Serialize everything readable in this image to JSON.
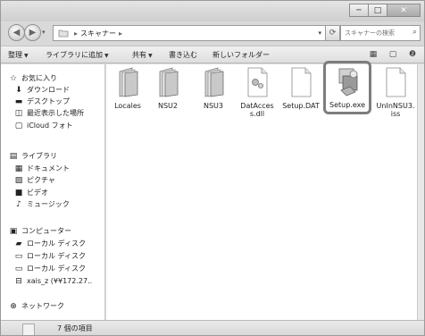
{
  "window": {
    "buttons": {
      "minimize": "─",
      "maximize": "□",
      "close": "✕"
    }
  },
  "nav": {
    "back": "◀",
    "forward": "▶",
    "history": "▾",
    "address_separator_1": "▸",
    "address_location": "スキャナー",
    "address_separator_2": "▸",
    "address_dropdown": "▾",
    "refresh": "⟳",
    "search_placeholder": "スキャナーの検索",
    "search_icon": "⌕"
  },
  "commandbar": {
    "items": [
      {
        "label": "整理",
        "dropdown": true
      },
      {
        "label": "ライブラリに追加",
        "dropdown": true
      },
      {
        "label": "共有",
        "dropdown": true
      },
      {
        "label": "書き込む",
        "dropdown": false
      },
      {
        "label": "新しいフォルダー",
        "dropdown": false
      }
    ],
    "dropdown_arrow": "▼",
    "right_icons": [
      "view-icon",
      "preview-pane-icon",
      "help-icon"
    ]
  },
  "sidebar": {
    "items": [
      {
        "label": "お気に入り",
        "icon": "star-icon",
        "glyph": "☆"
      },
      {
        "label": "ダウンロード",
        "icon": "download-icon",
        "glyph": "⬇"
      },
      {
        "label": "デスクトップ",
        "icon": "desktop-icon",
        "glyph": "▬"
      },
      {
        "label": "最近表示した場所",
        "icon": "recent-places-icon",
        "glyph": "◫"
      },
      {
        "label": "iCloud フォト",
        "icon": "icloud-icon",
        "glyph": "▢"
      },
      {
        "label": "ライブラリ",
        "icon": "library-icon",
        "glyph": "▤"
      },
      {
        "label": "ドキュメント",
        "icon": "document-icon",
        "glyph": "▦"
      },
      {
        "label": "ピクチャ",
        "icon": "picture-icon",
        "glyph": "▨"
      },
      {
        "label": "ビデオ",
        "icon": "video-icon",
        "glyph": "■"
      },
      {
        "label": "ミュージック",
        "icon": "music-icon",
        "glyph": "♪"
      },
      {
        "label": "コンピューター",
        "icon": "computer-icon",
        "glyph": "▣"
      },
      {
        "label": "ローカル ディスク",
        "icon": "local-disk-icon",
        "glyph": "▰"
      },
      {
        "label": "ローカル ディスク",
        "icon": "local-disk-icon",
        "glyph": "▭"
      },
      {
        "label": "ローカル ディスク",
        "icon": "local-disk-icon",
        "glyph": "▭"
      },
      {
        "label": "xais_z (¥¥172.27..",
        "icon": "network-drive-icon",
        "glyph": "⊟"
      },
      {
        "label": "ネットワーク",
        "icon": "network-icon",
        "glyph": "⊕"
      }
    ]
  },
  "files": [
    {
      "name": "Locales",
      "type": "folder"
    },
    {
      "name": "NSU2",
      "type": "folder"
    },
    {
      "name": "NSU3",
      "type": "folder"
    },
    {
      "name": "DatAccess.dll",
      "type": "dll"
    },
    {
      "name": "Setup.DAT",
      "type": "file"
    },
    {
      "name": "Setup.exe",
      "type": "exe",
      "highlighted": true
    },
    {
      "name": "UnInNSU3.iss",
      "type": "file"
    }
  ],
  "status": {
    "text": "7 個の項目"
  }
}
